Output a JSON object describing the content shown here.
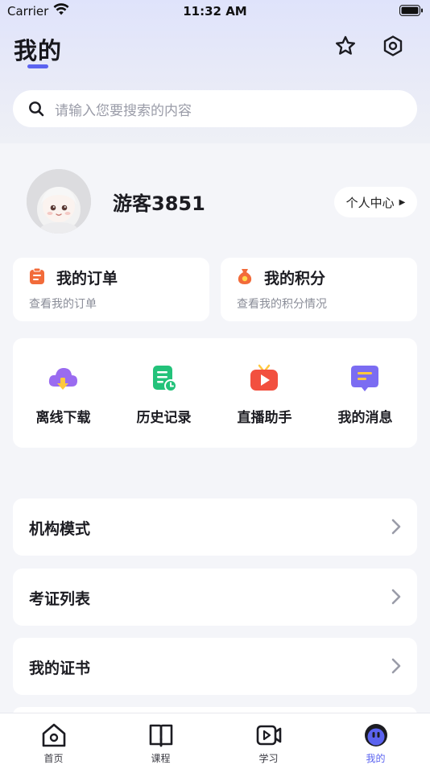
{
  "status_bar": {
    "carrier": "Carrier",
    "time": "11:32 AM"
  },
  "header": {
    "title": "我的",
    "accent_color": "#5b63f0"
  },
  "search": {
    "placeholder": "请输入您要搜索的内容"
  },
  "user": {
    "name": "游客3851",
    "profile_button": "个人中心"
  },
  "cards": [
    {
      "title": "我的订单",
      "subtitle": "查看我的订单",
      "icon": "clipboard-icon",
      "color": "#f26b3a"
    },
    {
      "title": "我的积分",
      "subtitle": "查看我的积分情况",
      "icon": "money-bag-icon",
      "color": "#f26b3a"
    }
  ],
  "tools": [
    {
      "label": "离线下载",
      "icon": "cloud-download-icon"
    },
    {
      "label": "历史记录",
      "icon": "history-doc-icon"
    },
    {
      "label": "直播助手",
      "icon": "live-tv-icon"
    },
    {
      "label": "我的消息",
      "icon": "message-icon"
    }
  ],
  "menu": [
    {
      "label": "机构模式"
    },
    {
      "label": "考证列表"
    },
    {
      "label": "我的证书"
    }
  ],
  "tabbar": [
    {
      "label": "首页",
      "icon": "home-icon"
    },
    {
      "label": "课程",
      "icon": "book-icon"
    },
    {
      "label": "学习",
      "icon": "video-play-icon"
    },
    {
      "label": "我的",
      "icon": "profile-face-icon",
      "active": true
    }
  ]
}
